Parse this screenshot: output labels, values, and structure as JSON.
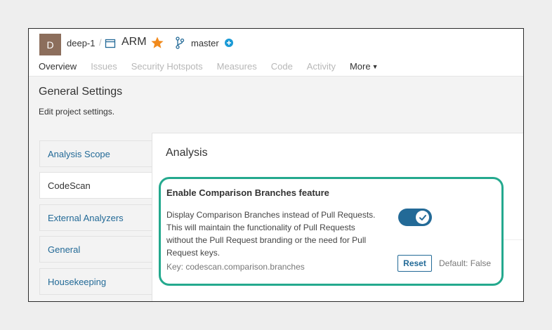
{
  "header": {
    "avatar_letter": "D",
    "org": "deep-1",
    "separator": "/",
    "project": "ARM",
    "branch": "master"
  },
  "nav": {
    "tabs": [
      {
        "label": "Overview",
        "state": "active"
      },
      {
        "label": "Issues",
        "state": "disabled"
      },
      {
        "label": "Security Hotspots",
        "state": "disabled"
      },
      {
        "label": "Measures",
        "state": "disabled"
      },
      {
        "label": "Code",
        "state": "disabled"
      },
      {
        "label": "Activity",
        "state": "disabled"
      }
    ],
    "more_label": "More"
  },
  "page": {
    "title": "General Settings",
    "description": "Edit project settings."
  },
  "sidebar": {
    "items": [
      {
        "label": "Analysis Scope"
      },
      {
        "label": "CodeScan",
        "active": true
      },
      {
        "label": "External Analyzers"
      },
      {
        "label": "General"
      },
      {
        "label": "Housekeeping"
      }
    ]
  },
  "section": {
    "title": "Analysis"
  },
  "setting": {
    "title": "Enable Comparison Branches feature",
    "description": "Display Comparison Branches instead of Pull Requests. This will maintain the functionality of Pull Requests without the Pull Request branding or the need for Pull Request keys.",
    "key": "Key: codescan.comparison.branches",
    "enabled": true,
    "reset_label": "Reset",
    "default_text": "Default: False"
  },
  "colors": {
    "accent": "#236a97",
    "highlight": "#24a98e",
    "star": "#f18a1c",
    "avatar": "#8c6e5c"
  }
}
